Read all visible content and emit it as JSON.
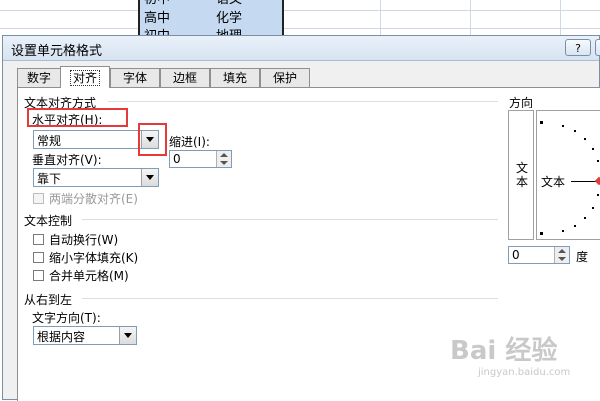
{
  "sheet": {
    "rows": [
      {
        "col1": "初中",
        "col2": "语文"
      },
      {
        "col1": "高中",
        "col2": "化学"
      },
      {
        "col1": "初中",
        "col2": "地理"
      }
    ]
  },
  "dialog": {
    "title": "设置单元格格式",
    "help_label": "?",
    "close_label": "✕",
    "tabs": [
      "数字",
      "对齐",
      "字体",
      "边框",
      "填充",
      "保护"
    ],
    "active_tab": "对齐"
  },
  "alignment": {
    "section_title": "文本对齐方式",
    "horizontal_label": "水平对齐(H):",
    "horizontal_value": "常规",
    "indent_label": "缩进(I):",
    "indent_value": "0",
    "vertical_label": "垂直对齐(V):",
    "vertical_value": "靠下",
    "distributed_label": "两端分散对齐(E)"
  },
  "text_control": {
    "section_title": "文本控制",
    "wrap_label": "自动换行(W)",
    "shrink_label": "缩小字体填充(K)",
    "merge_label": "合并单元格(M)"
  },
  "rtl": {
    "section_title": "从右到左",
    "direction_label": "文字方向(T):",
    "direction_value": "根据内容"
  },
  "orientation": {
    "section_title": "方向",
    "vertical_text": "文本",
    "horizontal_text": "文本",
    "degrees_value": "0",
    "degrees_label": "度"
  },
  "watermark": {
    "text": "Bai 经验",
    "sub": "jingyan.baidu.com"
  },
  "colors": {
    "highlight": "#e53a3a",
    "selection": "#c5d9f1"
  }
}
